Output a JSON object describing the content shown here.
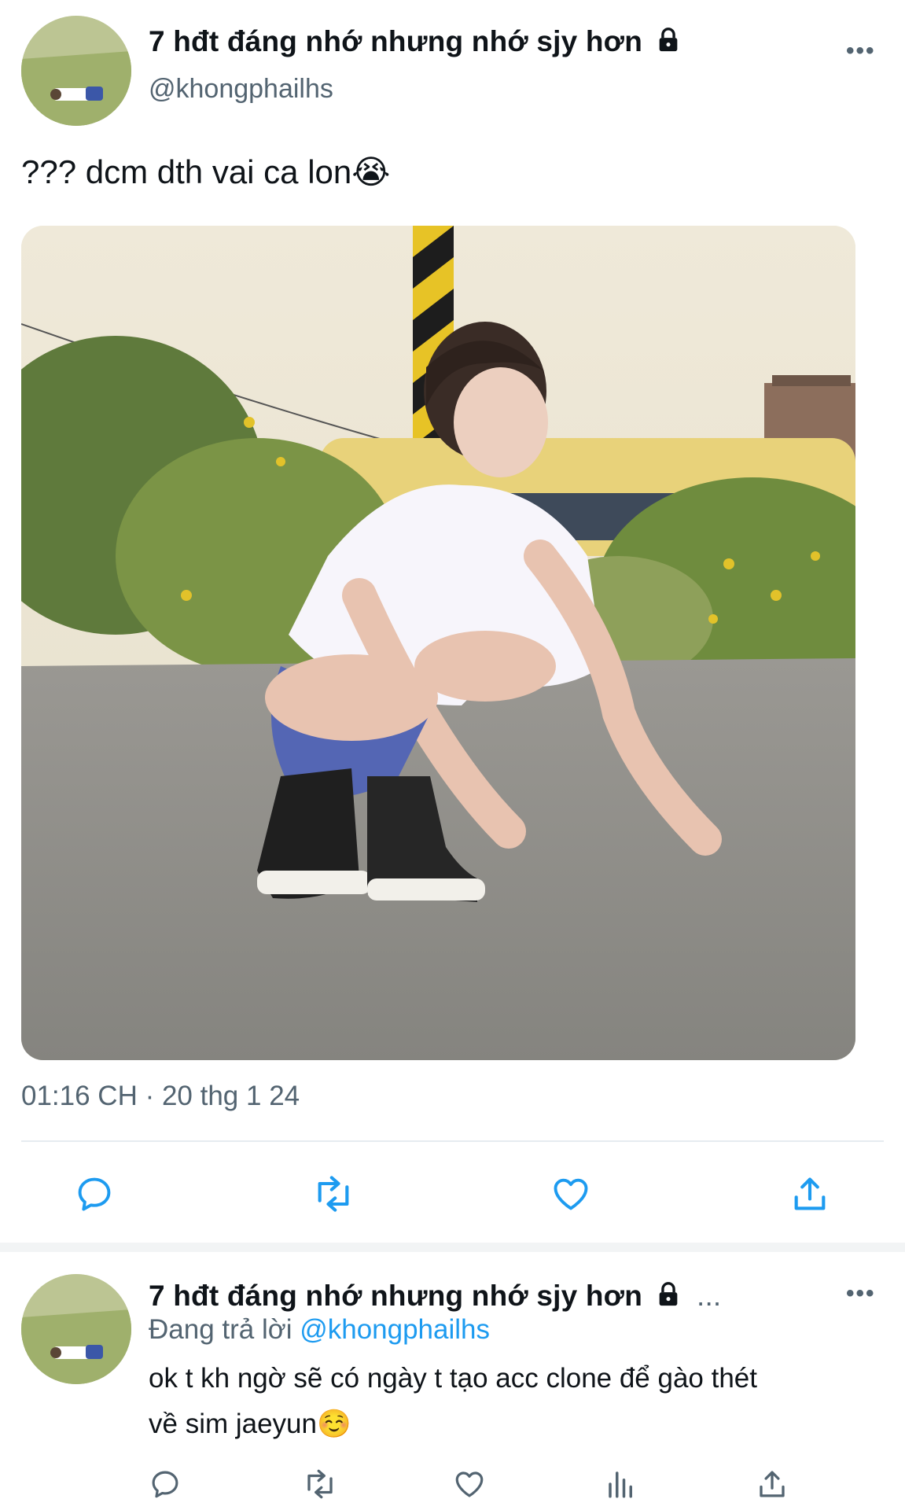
{
  "tweet": {
    "display_name": "7 hđt đáng nhớ nhưng nhớ sjy hơn",
    "handle": "@khongphailhs",
    "more_label": "•••",
    "text": "??? dcm dth vai ca lon😭",
    "timestamp": "01:16 CH · 20 thg 1 24"
  },
  "reply": {
    "display_name": "7 hđt đáng nhớ nhưng nhớ sjy hơn",
    "ellipsis": "...",
    "more_label": "•••",
    "replying_prefix": "Đang trả lời",
    "replying_to": "@khongphailhs",
    "text_line1": "ok t kh ngờ sẽ có ngày t tạo acc clone để gào thét",
    "text_line2": "về sim jaeyun☺️"
  },
  "icons": {
    "lock": "lock-icon",
    "reply": "reply-icon",
    "retweet": "retweet-icon",
    "like": "heart-icon",
    "share": "share-icon",
    "views": "views-icon"
  },
  "colors": {
    "accent": "#1d9bf0",
    "secondary_text": "#536471",
    "icon": "#1d9bf0"
  }
}
